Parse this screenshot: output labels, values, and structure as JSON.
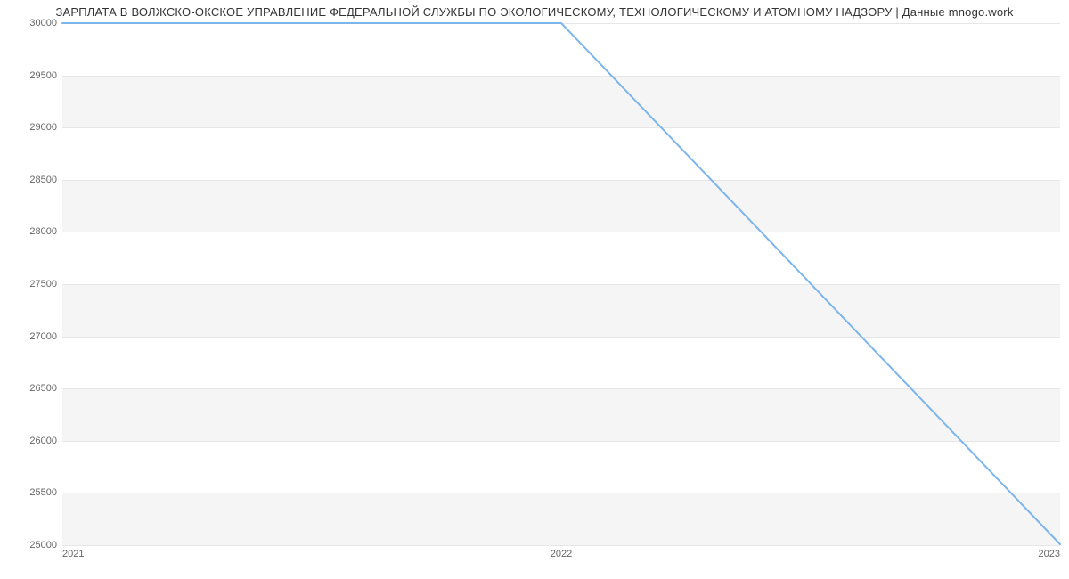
{
  "chart_data": {
    "type": "line",
    "title": "ЗАРПЛАТА В ВОЛЖСКО-ОКСКОЕ УПРАВЛЕНИЕ ФЕДЕРАЛЬНОЙ СЛУЖБЫ ПО ЭКОЛОГИЧЕСКОМУ, ТЕХНОЛОГИЧЕСКОМУ И АТОМНОМУ НАДЗОРУ | Данные mnogo.work",
    "x": [
      2021,
      2022,
      2023
    ],
    "values": [
      30000,
      30000,
      25000
    ],
    "x_ticks": [
      2021,
      2022,
      2023
    ],
    "y_ticks": [
      25000,
      25500,
      26000,
      26500,
      27000,
      27500,
      28000,
      28500,
      29000,
      29500,
      30000
    ],
    "xlabel": "",
    "ylabel": "",
    "xlim": [
      2021,
      2023
    ],
    "ylim": [
      25000,
      30000
    ],
    "colors": {
      "line": "#7cb5ec",
      "band": "#f5f5f5",
      "grid": "#e6e6e6"
    }
  }
}
